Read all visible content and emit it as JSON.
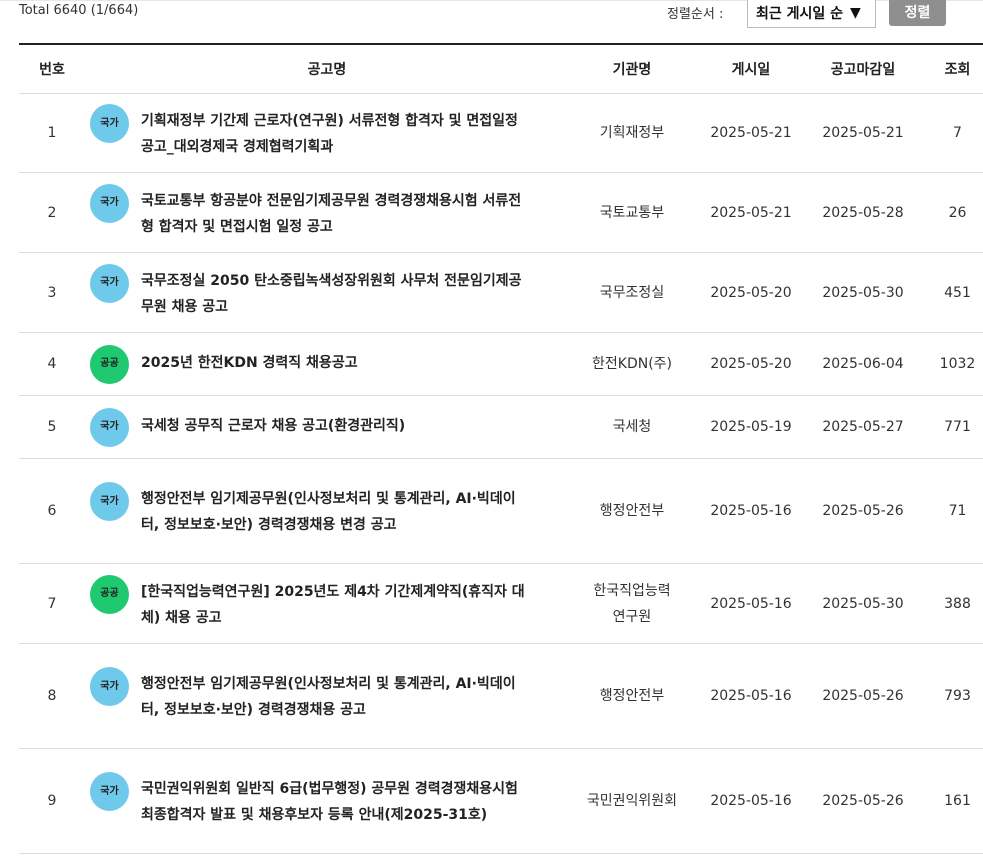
{
  "header": {
    "total_text": "Total 6640 (1/664)",
    "sort_label": "정렬순서 :",
    "sort_selected": "최근 게시일 순",
    "sort_button": "정렬"
  },
  "columns": [
    "번호",
    "공고명",
    "기관명",
    "게시일",
    "공고마감일",
    "조회"
  ],
  "rows": [
    {
      "no": "1",
      "badge": "국가",
      "badge_color": "#6fc9ea",
      "title": "기획재정부 기간제 근로자(연구원) 서류전형 합격자 및 면접일정 공고_대외경제국 경제협력기획과",
      "agency": "기획재정부",
      "posted": "2025-05-21",
      "deadline": "2025-05-21",
      "views": "7"
    },
    {
      "no": "2",
      "badge": "국가",
      "badge_color": "#6fc9ea",
      "title": "국토교통부 항공분야 전문임기제공무원 경력경쟁채용시험 서류전형 합격자 및 면접시험 일정 공고",
      "agency": "국토교통부",
      "posted": "2025-05-21",
      "deadline": "2025-05-28",
      "views": "26"
    },
    {
      "no": "3",
      "badge": "국가",
      "badge_color": "#6fc9ea",
      "title": "국무조정실 2050 탄소중립녹색성장위원회 사무처 전문임기제공무원 채용 공고",
      "agency": "국무조정실",
      "posted": "2025-05-20",
      "deadline": "2025-05-30",
      "views": "451"
    },
    {
      "no": "4",
      "badge": "공공",
      "badge_color": "#1fc96f",
      "title": "2025년 한전KDN 경력직 채용공고",
      "agency": "한전KDN(주)",
      "posted": "2025-05-20",
      "deadline": "2025-06-04",
      "views": "1032"
    },
    {
      "no": "5",
      "badge": "국가",
      "badge_color": "#6fc9ea",
      "title": "국세청 공무직 근로자 채용 공고(환경관리직)",
      "agency": "국세청",
      "posted": "2025-05-19",
      "deadline": "2025-05-27",
      "views": "771"
    },
    {
      "no": "6",
      "badge": "국가",
      "badge_color": "#6fc9ea",
      "title": "행정안전부 임기제공무원(인사정보처리 및 통계관리, AI·빅데이터, 정보보호·보안) 경력경쟁채용 변경 공고",
      "agency": "행정안전부",
      "posted": "2025-05-16",
      "deadline": "2025-05-26",
      "views": "71"
    },
    {
      "no": "7",
      "badge": "공공",
      "badge_color": "#1fc96f",
      "title": "[한국직업능력연구원] 2025년도 제4차 기간제계약직(휴직자 대체) 채용 공고",
      "agency": "한국직업능력연구원",
      "posted": "2025-05-16",
      "deadline": "2025-05-30",
      "views": "388"
    },
    {
      "no": "8",
      "badge": "국가",
      "badge_color": "#6fc9ea",
      "title": "행정안전부 임기제공무원(인사정보처리 및 통계관리, AI·빅데이터, 정보보호·보안) 경력경쟁채용 공고",
      "agency": "행정안전부",
      "posted": "2025-05-16",
      "deadline": "2025-05-26",
      "views": "793"
    },
    {
      "no": "9",
      "badge": "국가",
      "badge_color": "#6fc9ea",
      "title": "국민권익위원회 일반직 6급(법무행정) 공무원 경력경쟁채용시험 최종합격자 발표 및 채용후보자 등록 안내(제2025-31호)",
      "agency": "국민권익위원회",
      "posted": "2025-05-16",
      "deadline": "2025-05-26",
      "views": "161"
    }
  ]
}
